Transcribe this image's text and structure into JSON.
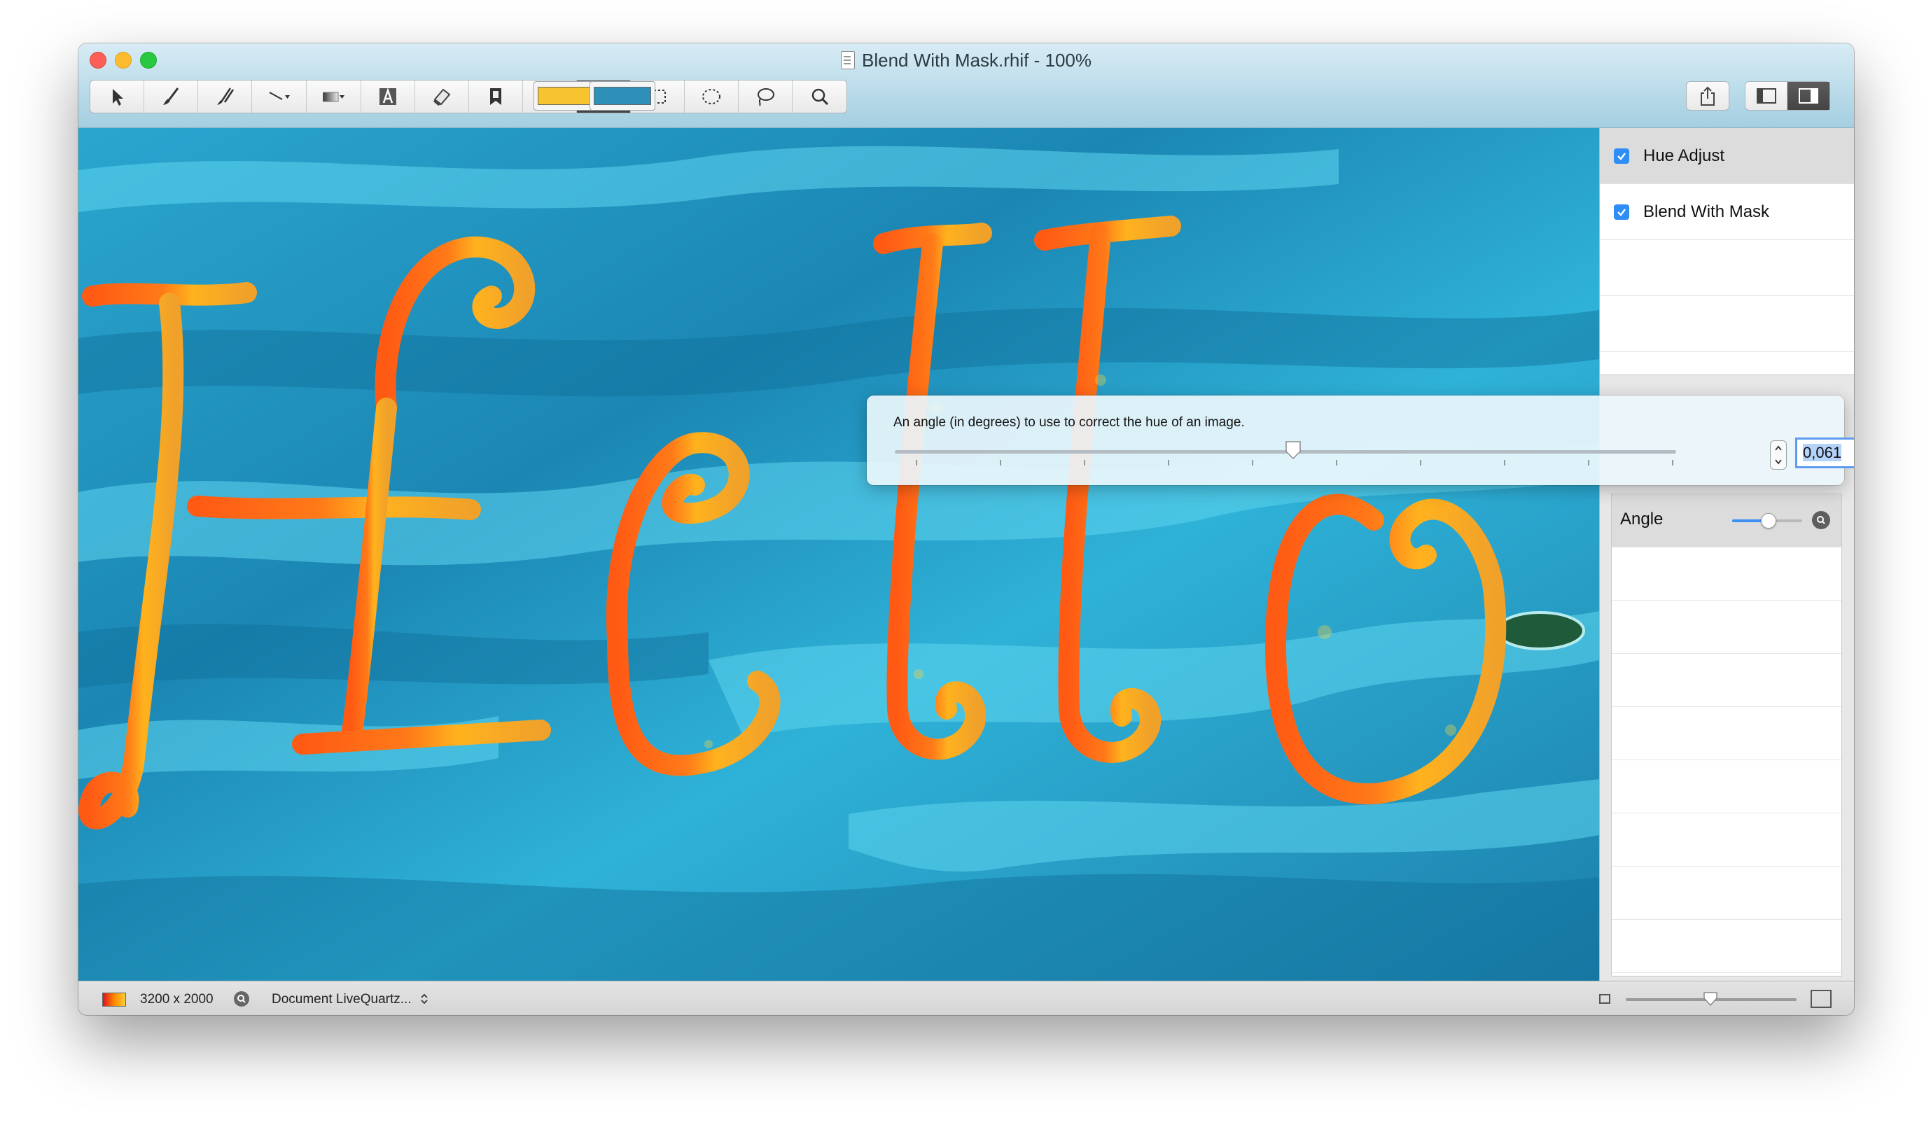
{
  "window": {
    "title": "Blend With Mask.rhif - 100%"
  },
  "toolbar": {
    "tools": [
      {
        "name": "select-arrow-icon"
      },
      {
        "name": "brush-icon"
      },
      {
        "name": "multi-brush-icon"
      },
      {
        "name": "line-icon"
      },
      {
        "name": "gradient-icon"
      },
      {
        "name": "text-icon"
      },
      {
        "name": "eraser-icon"
      },
      {
        "name": "stamp-icon"
      },
      {
        "name": "swirl-icon"
      },
      {
        "name": "pipette-icon",
        "selected": true
      },
      {
        "name": "rect-select-icon"
      },
      {
        "name": "ellipse-select-icon"
      },
      {
        "name": "lasso-icon"
      },
      {
        "name": "zoom-icon"
      }
    ],
    "primary_color": "#f5c42e",
    "secondary_color": "#2e90b8"
  },
  "layers": [
    {
      "label": "Hue Adjust",
      "checked": true,
      "selected": true
    },
    {
      "label": "Blend With Mask",
      "checked": true,
      "selected": false
    }
  ],
  "popover": {
    "description": "An angle (in degrees) to use to correct the hue of an image.",
    "value": "0,061",
    "slider_fraction": 0.51
  },
  "parameters": {
    "angle_label": "Angle",
    "angle_fraction": 0.51
  },
  "canvas_text": "Hello",
  "statusbar": {
    "dimensions": "3200 x 2000",
    "document_mode": "Document LiveQuartz..."
  }
}
